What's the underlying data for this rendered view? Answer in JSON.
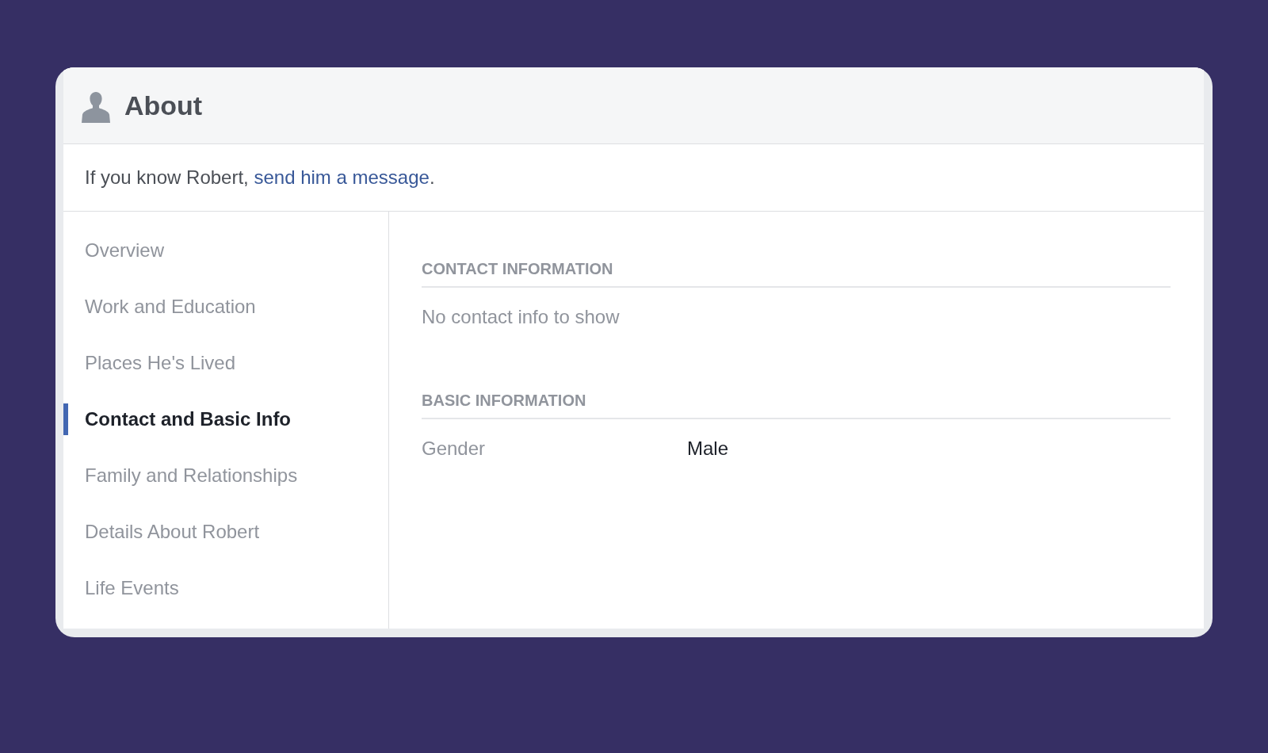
{
  "header": {
    "title": "About"
  },
  "notice": {
    "before": "If you know Robert,",
    "link": "send him a message",
    "after": "."
  },
  "nav": [
    {
      "label": "Overview",
      "selected": false
    },
    {
      "label": "Work and Education",
      "selected": false
    },
    {
      "label": "Places He's Lived",
      "selected": false
    },
    {
      "label": "Contact and Basic Info",
      "selected": true
    },
    {
      "label": "Family and Relationships",
      "selected": false
    },
    {
      "label": "Details About Robert",
      "selected": false
    },
    {
      "label": "Life Events",
      "selected": false
    }
  ],
  "sections": [
    {
      "kind": "empty",
      "heading": "CONTACT INFORMATION",
      "text": "No contact info to show"
    },
    {
      "kind": "fields",
      "heading": "BASIC INFORMATION",
      "fields": [
        {
          "label": "Gender",
          "value": "Male"
        }
      ]
    }
  ]
}
